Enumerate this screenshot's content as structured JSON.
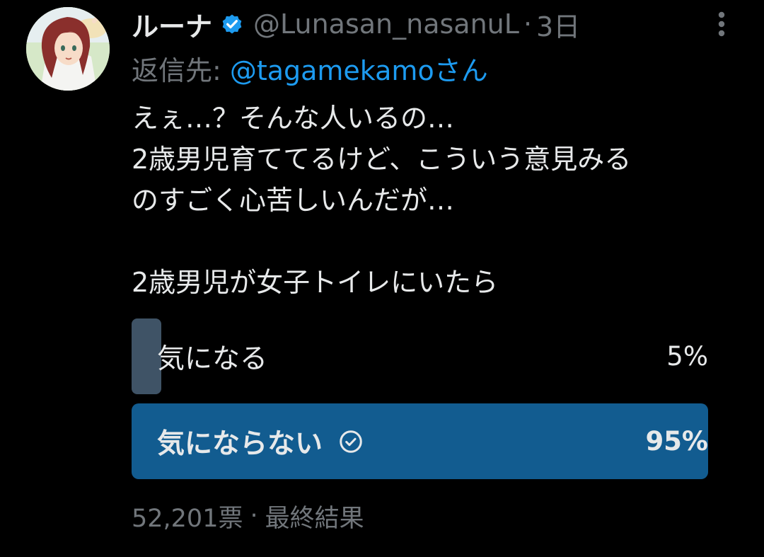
{
  "tweet": {
    "display_name": "ルーナ",
    "verified": true,
    "handle": "@Lunasan_nasanuL",
    "separator": "·",
    "time": "3日",
    "reply_label": "返信先:",
    "reply_target": "@tagamekamoさん",
    "text_lines": [
      "えぇ…？そんな人いるの…",
      "2歳男児育ててるけど、こういう意見みる",
      "のすごく心苦しいんだが…",
      "",
      "2歳男児が女子トイレにいたら"
    ]
  },
  "poll": {
    "options": [
      {
        "label": "気になる",
        "percent_text": "5%",
        "percent": 5,
        "voted": false
      },
      {
        "label": "気にならない",
        "percent_text": "95%",
        "percent": 95,
        "voted": true
      }
    ],
    "votes_text": "52,201票",
    "separator": "·",
    "status": "最終結果"
  },
  "colors": {
    "background": "#000000",
    "primary_text": "#e7e9ea",
    "secondary_text": "#71767b",
    "link": "#1d9bf0",
    "winning_bar": "#125c90",
    "losing_bar": "#3f5366"
  },
  "icons": {
    "verified": "verified-badge-icon",
    "more": "more-vertical-icon",
    "voted": "check-circle-icon"
  }
}
